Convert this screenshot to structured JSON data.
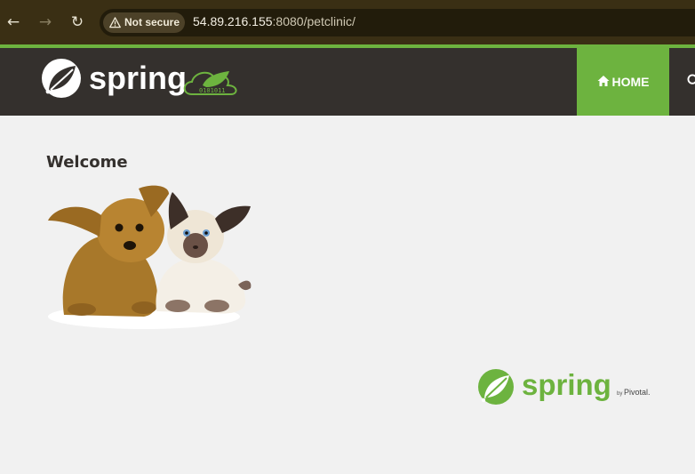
{
  "browser": {
    "back_icon": "arrow-left-icon",
    "forward_icon": "arrow-right-icon",
    "reload_icon": "reload-icon",
    "security_label": "Not secure",
    "url_host": "54.89.216.155",
    "url_rest": ":8080/petclinic/"
  },
  "header": {
    "logo_text": "spring",
    "logo_badge_digits": "0101011",
    "nav": {
      "home_label": "HOME",
      "home_icon": "home-icon",
      "find_icon": "search-icon"
    }
  },
  "main": {
    "welcome_title": "Welcome",
    "image": "pets-image"
  },
  "footer": {
    "logo_text": "spring",
    "by_text": "by",
    "pivotal_text": "Pivotal."
  },
  "colors": {
    "accent": "#6db33f",
    "header_bg": "#34302d",
    "page_bg": "#f1f1f1"
  }
}
